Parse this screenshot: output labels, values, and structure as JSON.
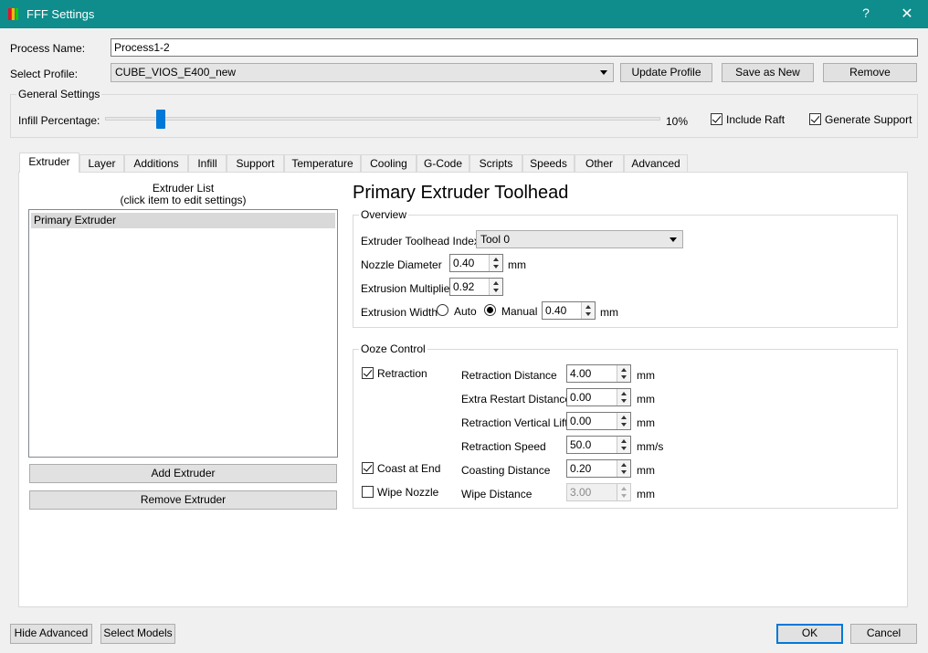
{
  "window": {
    "title": "FFF Settings",
    "help_glyph": "?",
    "close_glyph": "✕",
    "app_icon_colors": [
      "#e81123",
      "#ffb900",
      "#16c60c"
    ]
  },
  "header": {
    "process_name_label": "Process Name:",
    "process_name_value": "Process1-2",
    "select_profile_label": "Select Profile:",
    "select_profile_value": "CUBE_VIOS_E400_new",
    "update_profile": "Update Profile",
    "save_as_new": "Save as New",
    "remove": "Remove"
  },
  "general": {
    "group_title": "General Settings",
    "infill_label": "Infill Percentage:",
    "infill_value": "10%",
    "infill_level": 0.1,
    "include_raft": {
      "label": "Include Raft",
      "checked": true
    },
    "generate_support": {
      "label": "Generate Support",
      "checked": true
    }
  },
  "tabs": [
    {
      "label": "Extruder",
      "active": true
    },
    {
      "label": "Layer"
    },
    {
      "label": "Additions"
    },
    {
      "label": "Infill"
    },
    {
      "label": "Support"
    },
    {
      "label": "Temperature"
    },
    {
      "label": "Cooling"
    },
    {
      "label": "G-Code"
    },
    {
      "label": "Scripts"
    },
    {
      "label": "Speeds"
    },
    {
      "label": "Other"
    },
    {
      "label": "Advanced"
    }
  ],
  "extruder_list": {
    "title_line1": "Extruder List",
    "title_line2": "(click item to edit settings)",
    "items": [
      "Primary Extruder"
    ],
    "add_button": "Add Extruder",
    "remove_button": "Remove Extruder"
  },
  "toolhead": {
    "heading": "Primary Extruder Toolhead",
    "overview_title": "Overview",
    "index_label": "Extruder Toolhead Index",
    "index_value": "Tool 0",
    "nozzle_label": "Nozzle Diameter",
    "nozzle_value": "0.40",
    "nozzle_unit": "mm",
    "multiplier_label": "Extrusion Multiplier",
    "multiplier_value": "0.92",
    "width_label": "Extrusion Width",
    "width_auto": "Auto",
    "width_manual": "Manual",
    "width_mode": "manual",
    "width_value": "0.40",
    "width_unit": "mm"
  },
  "ooze": {
    "title": "Ooze Control",
    "retraction": {
      "label": "Retraction",
      "checked": true
    },
    "coast": {
      "label": "Coast at End",
      "checked": true
    },
    "wipe": {
      "label": "Wipe Nozzle",
      "checked": false
    },
    "fields": [
      {
        "label": "Retraction Distance",
        "value": "4.00",
        "unit": "mm"
      },
      {
        "label": "Extra Restart Distance",
        "value": "0.00",
        "unit": "mm"
      },
      {
        "label": "Retraction Vertical Lift",
        "value": "0.00",
        "unit": "mm"
      },
      {
        "label": "Retraction Speed",
        "value": "50.0",
        "unit": "mm/s"
      },
      {
        "label": "Coasting Distance",
        "value": "0.20",
        "unit": "mm"
      },
      {
        "label": "Wipe Distance",
        "value": "3.00",
        "unit": "mm",
        "disabled": true
      }
    ]
  },
  "footer": {
    "hide_advanced": "Hide Advanced",
    "select_models": "Select Models",
    "ok": "OK",
    "cancel": "Cancel"
  }
}
